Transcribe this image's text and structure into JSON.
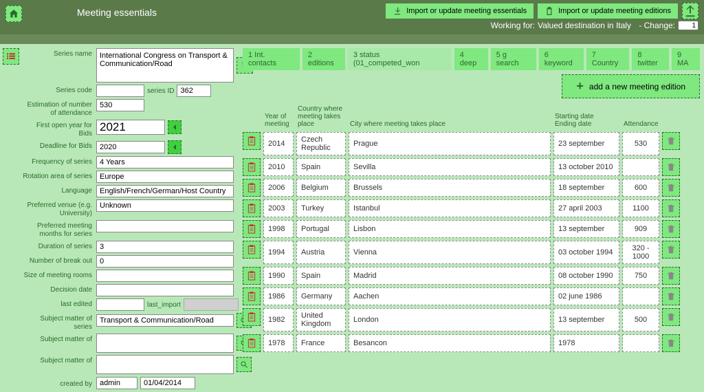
{
  "header": {
    "title": "Meeting essentials",
    "import_essentials": "Import or update meeting essentials",
    "import_editions": "Import or update meeting editions",
    "working_for_label": "Working for:",
    "working_for_value": "Valued destination in Italy",
    "change_label": "- Change:",
    "change_value": "1"
  },
  "form": {
    "series_name_label": "Series name",
    "series_name": "International Congress on Transport & Communication/Road",
    "series_code_label": "Series code",
    "series_code": "",
    "series_id_label": "series ID",
    "series_id": "362",
    "est_attendance_label": "Estimation of number of attendance",
    "est_attendance": "530",
    "first_open_label": "First open year for Bids",
    "first_open": "2021",
    "deadline_label": "Deadline for Bids",
    "deadline": "2020",
    "frequency_label": "Frequency of series",
    "frequency": "4 Years",
    "rotation_label": "Rotation area of series",
    "rotation": "Europe",
    "language_label": "Language",
    "language": "English/French/German/Host Country",
    "venue_label": "Preferred venue (e.g. University)",
    "venue": "Unknown",
    "months_label": "Preferred meeting months for series",
    "months": "",
    "duration_label": "Duration of series",
    "duration": "3",
    "breakout_label": "Number of break out",
    "breakout": "0",
    "rooms_label": "Size of meeting rooms",
    "rooms": "",
    "decision_label": "Decision date",
    "decision": "",
    "edited_label": "last edited",
    "edited": "",
    "last_import_label": "last_import",
    "subject1_label": "Subject matter of series",
    "subject1": "Transport & Communication/Road",
    "subject2_label": "Subject matter of",
    "subject2": "",
    "subject3_label": "Subject matter of",
    "subject3": "",
    "created_by_label": "created by",
    "created_by": "admin",
    "created_date": "01/04/2014"
  },
  "tabs": [
    "1 Int. contacts",
    "2 editions",
    "3 status (01_competed_won",
    "4 deep",
    "5 g search",
    "6 keyword",
    "7 Country",
    "8 twitter",
    "9 MA"
  ],
  "add_button": "add a new meeting edition",
  "columns": {
    "year": "Year of meeting",
    "country": "Country where meeting takes place",
    "city": "City where meeting takes place",
    "starting": "Starting date",
    "ending": "Ending date",
    "attendance": "Attendance"
  },
  "rows": [
    {
      "year": "2014",
      "country": "Czech Republic",
      "city": "Prague",
      "start": "23 september",
      "att": "530"
    },
    {
      "year": "2010",
      "country": "Spain",
      "city": "Sevilla",
      "start": "13 october 2010",
      "att": ""
    },
    {
      "year": "2006",
      "country": "Belgium",
      "city": "Brussels",
      "start": "18 september",
      "att": "600"
    },
    {
      "year": "2003",
      "country": "Turkey",
      "city": "Istanbul",
      "start": "27 april 2003",
      "att": "1100"
    },
    {
      "year": "1998",
      "country": "Portugal",
      "city": "Lisbon",
      "start": "13 september",
      "att": "909"
    },
    {
      "year": "1994",
      "country": "Austria",
      "city": "Vienna",
      "start": "03 october 1994",
      "att": "320 - 1000"
    },
    {
      "year": "1990",
      "country": "Spain",
      "city": "Madrid",
      "start": "08 october 1990",
      "att": "750"
    },
    {
      "year": "1986",
      "country": "Germany",
      "city": "Aachen",
      "start": "02 june 1986",
      "att": ""
    },
    {
      "year": "1982",
      "country": "United Kingdom",
      "city": "London",
      "start": "13 september",
      "att": "500"
    },
    {
      "year": "1978",
      "country": "France",
      "city": "Besancon",
      "start": "1978",
      "att": ""
    }
  ]
}
